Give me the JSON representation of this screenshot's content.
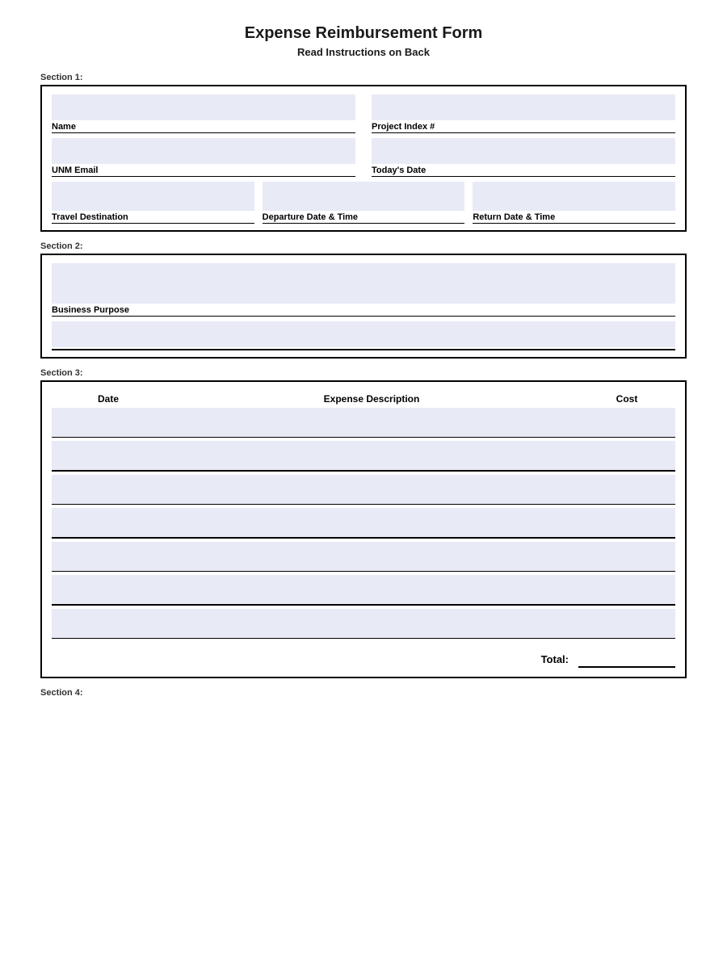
{
  "header": {
    "title": "Expense Reimbursement Form",
    "subtitle": "Read Instructions on Back"
  },
  "section1": {
    "label": "Section 1:",
    "fields": {
      "name_label": "Name",
      "project_index_label": "Project Index #",
      "unm_email_label": "UNM Email",
      "todays_date_label": "Today's Date",
      "travel_destination_label": "Travel Destination",
      "departure_label": "Departure Date & Time",
      "return_label": "Return Date & Time"
    }
  },
  "section2": {
    "label": "Section 2:",
    "fields": {
      "business_purpose_label": "Business Purpose"
    }
  },
  "section3": {
    "label": "Section 3:",
    "columns": {
      "date": "Date",
      "description": "Expense Description",
      "cost": "Cost"
    },
    "total_label": "Total:",
    "rows": 7
  },
  "section4": {
    "label": "Section 4:"
  }
}
